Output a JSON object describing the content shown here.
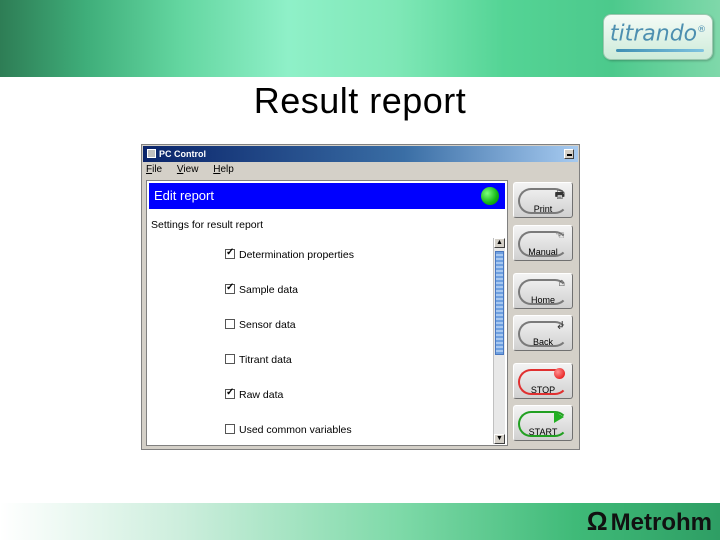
{
  "brand": {
    "logo_text": "titrando",
    "logo_mark": "®",
    "footer_logo": "Metrohm",
    "footer_symbol": "Ω"
  },
  "slide": {
    "title": "Result report"
  },
  "window": {
    "title": "PC Control",
    "menu": [
      {
        "label": "File",
        "key": "F",
        "rest": "ile"
      },
      {
        "label": "View",
        "key": "V",
        "rest": "iew"
      },
      {
        "label": "Help",
        "key": "H",
        "rest": "elp"
      }
    ],
    "header": "Edit report",
    "section_label": "Settings for result report",
    "options": [
      {
        "label": "Determination properties",
        "checked": true
      },
      {
        "label": "Sample data",
        "checked": true
      },
      {
        "label": "Sensor data",
        "checked": false
      },
      {
        "label": "Titrant data",
        "checked": false
      },
      {
        "label": "Raw data",
        "checked": true
      },
      {
        "label": "Used common variables",
        "checked": false
      }
    ],
    "buttons": [
      {
        "id": "print",
        "label": "Print",
        "icon": "printer-icon"
      },
      {
        "id": "manual",
        "label": "Manual",
        "icon": "hand-icon"
      },
      {
        "id": "home",
        "label": "Home",
        "icon": "home-icon"
      },
      {
        "id": "back",
        "label": "Back",
        "icon": "back-arrow-icon"
      },
      {
        "id": "stop",
        "label": "STOP",
        "icon": "stop-icon"
      },
      {
        "id": "start",
        "label": "START",
        "icon": "play-icon"
      }
    ],
    "colors": {
      "header_bg": "#0000ff",
      "status_led": "#11b511",
      "stop": "#e00000",
      "start": "#22b022"
    }
  }
}
